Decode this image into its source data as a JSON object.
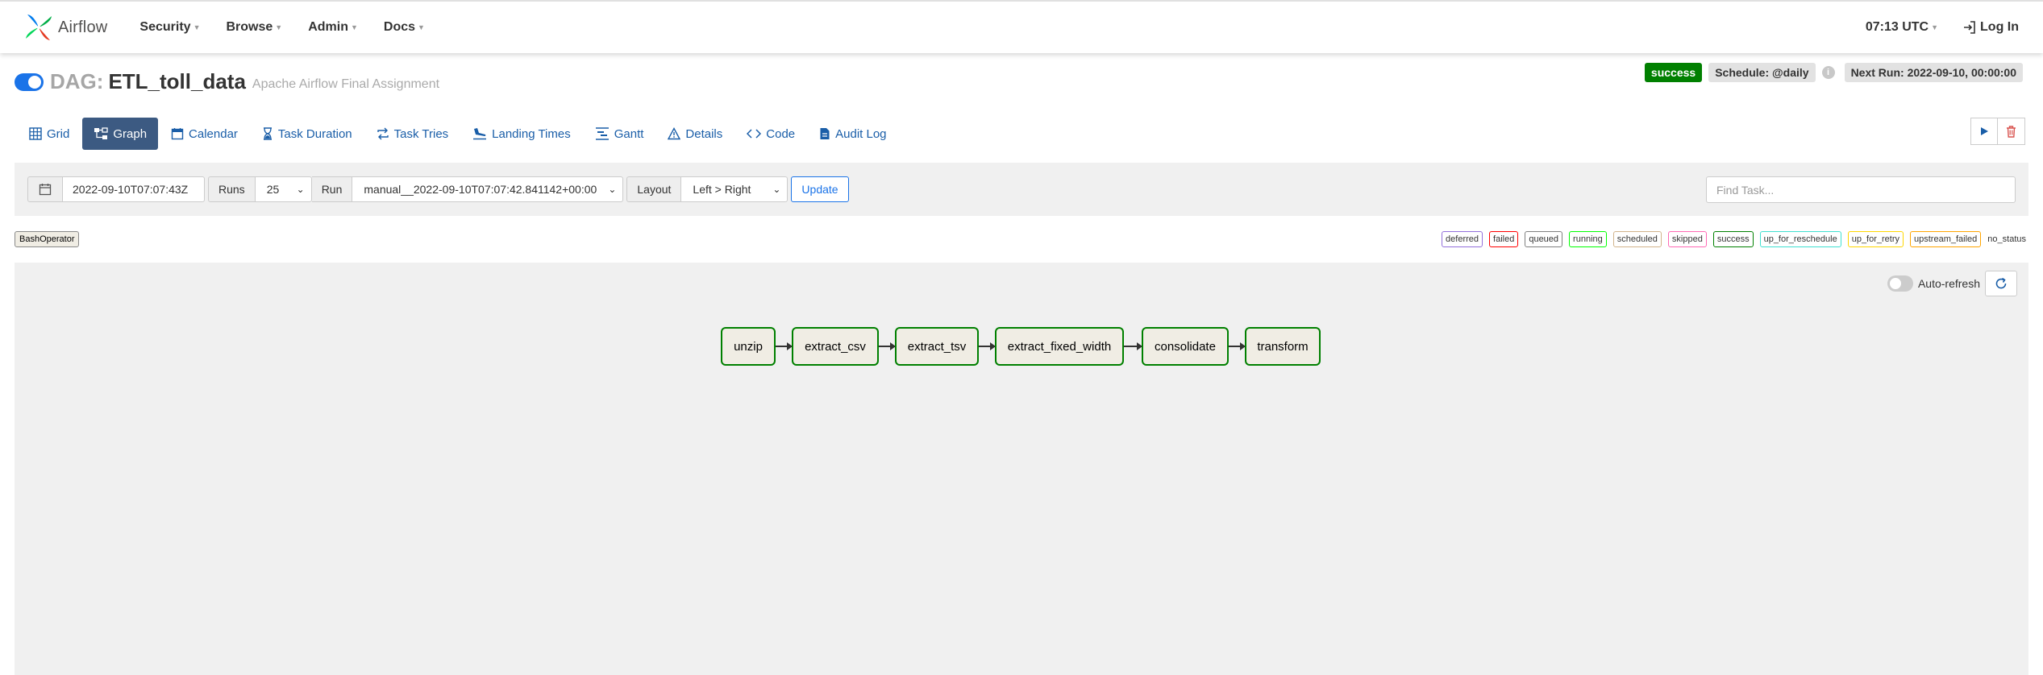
{
  "app": {
    "brand": "Airflow"
  },
  "nav": {
    "items": [
      {
        "label": "Security"
      },
      {
        "label": "Browse"
      },
      {
        "label": "Admin"
      },
      {
        "label": "Docs"
      }
    ],
    "time": "07:13 UTC",
    "login": "Log In"
  },
  "dag": {
    "prefix": "DAG:",
    "id": "ETL_toll_data",
    "description": "Apache Airflow Final Assignment",
    "status": "success",
    "schedule": "Schedule: @daily",
    "next_run": "Next Run: 2022-09-10, 00:00:00"
  },
  "tabs": [
    {
      "label": "Grid",
      "icon": "grid-icon"
    },
    {
      "label": "Graph",
      "icon": "graph-icon"
    },
    {
      "label": "Calendar",
      "icon": "calendar-icon"
    },
    {
      "label": "Task Duration",
      "icon": "hourglass-icon"
    },
    {
      "label": "Task Tries",
      "icon": "retry-icon"
    },
    {
      "label": "Landing Times",
      "icon": "landing-icon"
    },
    {
      "label": "Gantt",
      "icon": "gantt-icon"
    },
    {
      "label": "Details",
      "icon": "warning-icon"
    },
    {
      "label": "Code",
      "icon": "code-icon"
    },
    {
      "label": "Audit Log",
      "icon": "file-icon"
    }
  ],
  "controls": {
    "date": "2022-09-10T07:07:43Z",
    "runs_label": "Runs",
    "runs_value": "25",
    "run_label": "Run",
    "run_value": "manual__2022-09-10T07:07:42.841142+00:00",
    "layout_label": "Layout",
    "layout_value": "Left > Right",
    "update": "Update",
    "find_placeholder": "Find Task..."
  },
  "legend": {
    "operator": "BashOperator",
    "states": [
      {
        "label": "deferred",
        "color": "#9370db"
      },
      {
        "label": "failed",
        "color": "#ff0000"
      },
      {
        "label": "queued",
        "color": "#808080"
      },
      {
        "label": "running",
        "color": "#00ff00"
      },
      {
        "label": "scheduled",
        "color": "#d2b48c"
      },
      {
        "label": "skipped",
        "color": "#ff69b4"
      },
      {
        "label": "success",
        "color": "#008000"
      },
      {
        "label": "up_for_reschedule",
        "color": "#40e0d0"
      },
      {
        "label": "up_for_retry",
        "color": "#ffd700"
      },
      {
        "label": "upstream_failed",
        "color": "#ffa500"
      },
      {
        "label": "no_status",
        "color": ""
      }
    ]
  },
  "graph": {
    "auto_refresh": "Auto-refresh",
    "tasks": [
      "unzip",
      "extract_csv",
      "extract_tsv",
      "extract_fixed_width",
      "consolidate",
      "transform"
    ]
  }
}
